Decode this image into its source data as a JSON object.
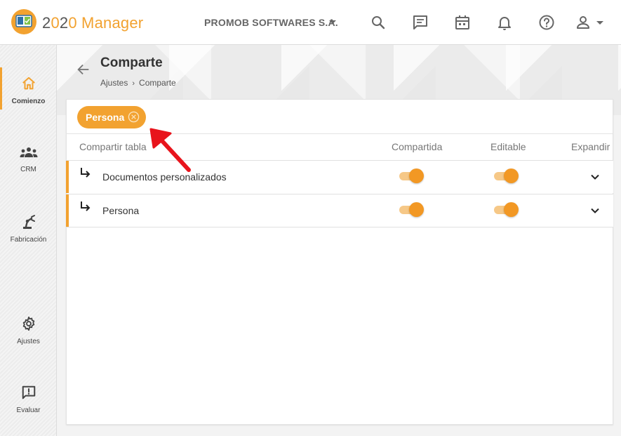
{
  "app": {
    "brand_prefix": "2",
    "brand_mid": "0",
    "brand_suffix": "2",
    "brand_last": "0",
    "brand_name": " Manager",
    "company": "PROMOB SOFTWARES S.A."
  },
  "topbar_icons": [
    "search-icon",
    "chat-icon",
    "calendar-icon",
    "bell-icon",
    "help-icon",
    "user-icon"
  ],
  "sidebar": {
    "items": [
      {
        "label": "Comienzo",
        "icon": "home-icon",
        "active": true
      },
      {
        "label": "CRM",
        "icon": "group-icon",
        "active": false
      },
      {
        "label": "Fabricación",
        "icon": "robot-arm-icon",
        "active": false
      },
      {
        "label": "Ajustes",
        "icon": "gear-icon",
        "active": false
      },
      {
        "label": "Evaluar",
        "icon": "feedback-icon",
        "active": false
      }
    ]
  },
  "page": {
    "title": "Comparte",
    "breadcrumb": [
      "Ajustes",
      "Comparte"
    ]
  },
  "filter_chip": {
    "label": "Persona"
  },
  "table": {
    "columns": [
      "Compartir tabla",
      "Compartida",
      "Editable",
      "Expandir"
    ],
    "rows": [
      {
        "name": "Documentos personalizados",
        "compartida": true,
        "editable": true
      },
      {
        "name": "Persona",
        "compartida": true,
        "editable": true
      }
    ]
  },
  "colors": {
    "accent": "#f2a230",
    "annotation": "#e8141c"
  }
}
